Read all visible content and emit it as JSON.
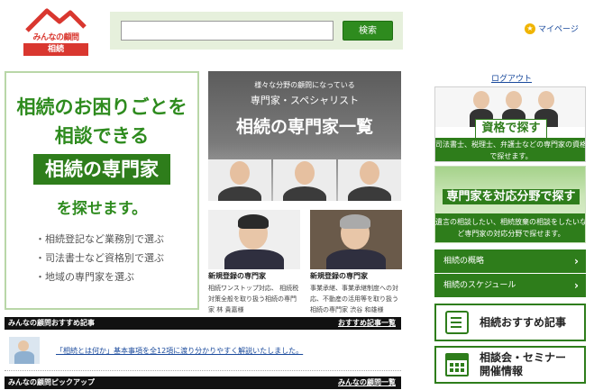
{
  "header": {
    "logo_text": "みんなの顧問",
    "logo_sub": "相続",
    "search_placeholder": "",
    "search_button": "検索",
    "mypage": "マイページ",
    "logout": "ログアウト"
  },
  "hero": {
    "line1": "相続のお困りごとを",
    "line2": "相談できる",
    "highlight": "相続の専門家",
    "line4": "を探せます。",
    "items": [
      "・相続登記など業務別で選ぶ",
      "・司法書士など資格別で選ぶ",
      "・地域の専門家を選ぶ"
    ]
  },
  "banner": {
    "sub": "様々な分野の顧問になっている",
    "spec": "専門家・スペシャリスト",
    "title": "相続の専門家一覧"
  },
  "experts": [
    {
      "title": "新規登録の専門家",
      "desc": "相続ワンストップ対応、 相続税対策全般を取り扱う相続の専門家 林 貴嘉様"
    },
    {
      "title": "新規登録の専門家",
      "desc": "事業承継、事業承継制度への対応、不動産の活用等を取り扱う相続の専門家 渋谷 和雄様"
    }
  ],
  "sections": {
    "recommended": {
      "title": "みんなの顧問おすすめ記事",
      "link": "おすすめ記事一覧"
    },
    "pickup": {
      "title": "みんなの顧問ピックアップ",
      "link": "みんなの顧問一覧"
    }
  },
  "article": {
    "text": "「相続とは何か」基本事項を全12項に渡り分かりやすく解説いたしました。"
  },
  "right": {
    "qualification": {
      "title": "資格で探す",
      "desc": "司法書士、税理士、弁護士などの専門家の資格で探せます。"
    },
    "field": {
      "title": "専門家を対応分野で探す",
      "desc": "遺言の相談したい、相続放棄の相談をしたいなど専門家の対応分野で探せます。"
    },
    "menu": [
      "相続の概略",
      "相続のスケジュール"
    ],
    "recommend_label": "相続おすすめ記事",
    "seminar_label_1": "相談会・セミナー",
    "seminar_label_2": "開催情報"
  },
  "colors": {
    "accent_green": "#2e7d1b",
    "brand_red": "#d9372f",
    "link_blue": "#1a4a9c"
  }
}
